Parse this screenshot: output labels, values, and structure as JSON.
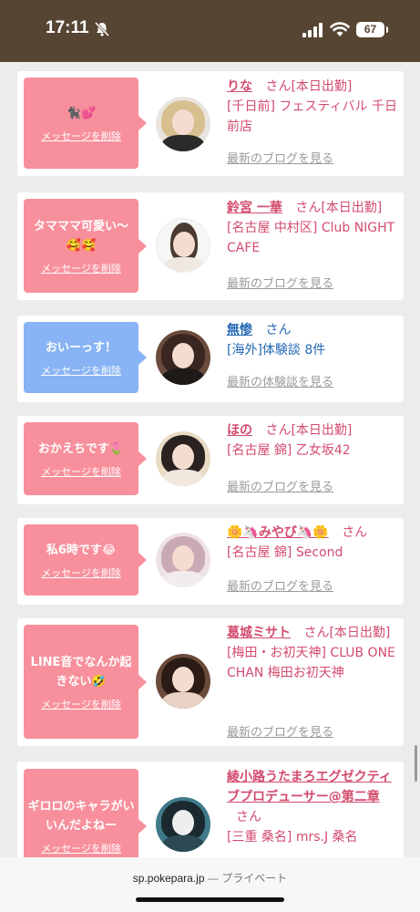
{
  "status": {
    "time": "17:11",
    "battery": "67"
  },
  "delete_label": "メッセージを削除",
  "blog_link": "最新のブログを見る",
  "exp_link": "最新の体験談を見る",
  "san": "さん",
  "shukkin": "[本日出勤]",
  "posts": [
    {
      "msg": "🐈‍⬛💕",
      "name": "りな",
      "shop": "[千日前] フェスティバル 千日前店"
    },
    {
      "msg": "タマママ可愛い〜🥰🥰",
      "name": "鈴宮 一華",
      "shop": "[名古屋 中村区] Club NIGHT CAFE"
    },
    {
      "msg": "おいーっす！",
      "name": "無惨",
      "shop": "[海外]体験談 8件"
    },
    {
      "msg": "おかえちです🌷",
      "name": "ほの",
      "shop": "[名古屋 錦] 乙女坂42"
    },
    {
      "msg": "私6時です😂",
      "name": "🌼🦄みやび🦄🌼",
      "shop": "[名古屋 錦] Second"
    },
    {
      "msg": "LINE音でなんか起きない🤣",
      "name": "葛城ミサト",
      "shop": "[梅田・お初天神] CLUB ONE CHAN 梅田お初天神"
    },
    {
      "msg": "ギロロのキャラがいいんだよねー",
      "name": "綾小路うたまろエグゼクティブプロデューサー@第二章",
      "shop": "[三重 桑名] mrs.J 桑名"
    }
  ],
  "browser": {
    "url": "sp.pokepara.jp",
    "sep": "—",
    "mode": "プライベート"
  }
}
